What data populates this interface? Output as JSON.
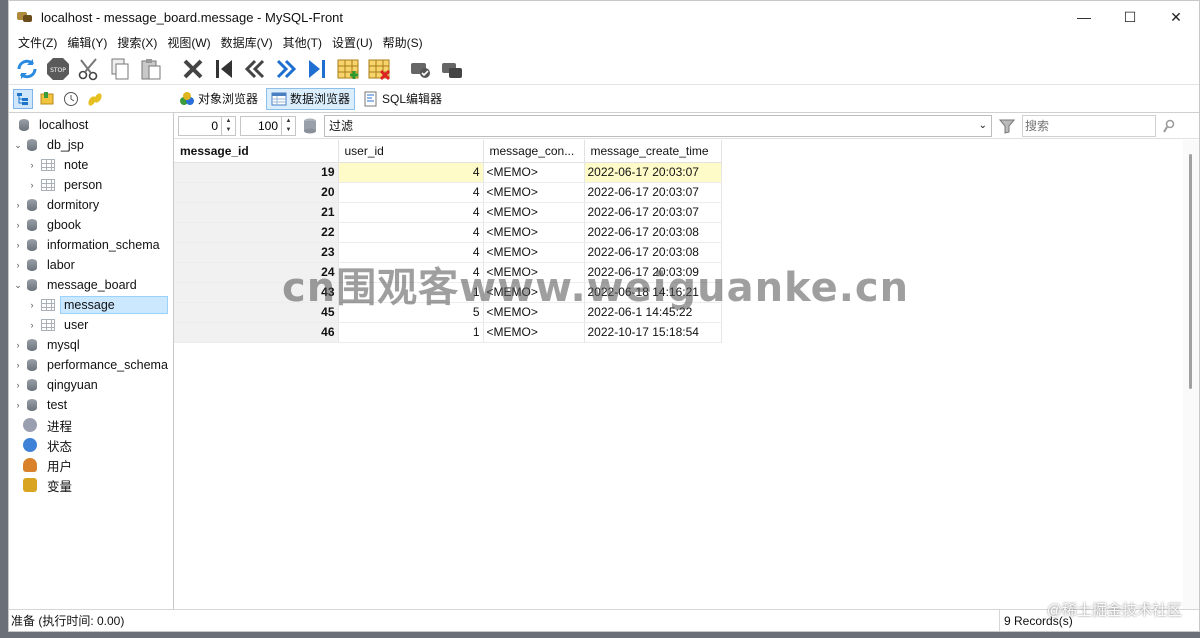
{
  "window": {
    "title": "localhost - message_board.message - MySQL-Front"
  },
  "menu": [
    "文件(Z)",
    "编辑(Y)",
    "搜索(X)",
    "视图(W)",
    "数据库(V)",
    "其他(T)",
    "设置(U)",
    "帮助(S)"
  ],
  "toolbar_icons": [
    "refresh-icon",
    "stop-icon",
    "cut-icon",
    "copy-icon",
    "paste-icon",
    "delete-icon",
    "first-record-icon",
    "previous-record-icon",
    "next-record-icon",
    "last-record-icon",
    "insert-record-icon",
    "delete-record-icon",
    "commit-icon",
    "rollback-icon"
  ],
  "tabs": [
    {
      "label": "对象浏览器",
      "active": false
    },
    {
      "label": "数据浏览器",
      "active": true
    },
    {
      "label": "SQL编辑器",
      "active": false
    }
  ],
  "tree": {
    "root": "localhost",
    "databases": [
      {
        "name": "db_jsp",
        "expanded": true,
        "tables": [
          "note",
          "person"
        ]
      },
      {
        "name": "dormitory"
      },
      {
        "name": "gbook"
      },
      {
        "name": "information_schema"
      },
      {
        "name": "labor"
      },
      {
        "name": "message_board",
        "expanded": true,
        "tables": [
          "message",
          "user"
        ]
      },
      {
        "name": "mysql"
      },
      {
        "name": "performance_schema"
      },
      {
        "name": "qingyuan"
      },
      {
        "name": "test"
      }
    ],
    "extras": [
      "进程",
      "状态",
      "用户",
      "变量"
    ]
  },
  "filter": {
    "offset": "0",
    "limit": "100",
    "placeholder": "过滤",
    "search_placeholder": "搜索"
  },
  "grid": {
    "columns": [
      "message_id",
      "user_id",
      "message_con...",
      "message_create_time"
    ],
    "rows": [
      [
        "19",
        "4",
        "<MEMO>",
        "2022-06-17 20:03:07"
      ],
      [
        "20",
        "4",
        "<MEMO>",
        "2022-06-17 20:03:07"
      ],
      [
        "21",
        "4",
        "<MEMO>",
        "2022-06-17 20:03:07"
      ],
      [
        "22",
        "4",
        "<MEMO>",
        "2022-06-17 20:03:08"
      ],
      [
        "23",
        "4",
        "<MEMO>",
        "2022-06-17 20:03:08"
      ],
      [
        "24",
        "4",
        "<MEMO>",
        "2022-06-17 20:03:09"
      ],
      [
        "43",
        "1",
        "<MEMO>",
        "2022-06-18 14:16:21"
      ],
      [
        "45",
        "5",
        "<MEMO>",
        "2022-06-1  14:45:22"
      ],
      [
        "46",
        "1",
        "<MEMO>",
        "2022-10-17 15:18:54"
      ]
    ]
  },
  "watermark": "cn围观客www.weiguanke.cn",
  "status": {
    "left": "准备  (执行时间: 0.00)",
    "right": "9 Records(s)"
  },
  "credit": "@稀土掘金技术社区"
}
